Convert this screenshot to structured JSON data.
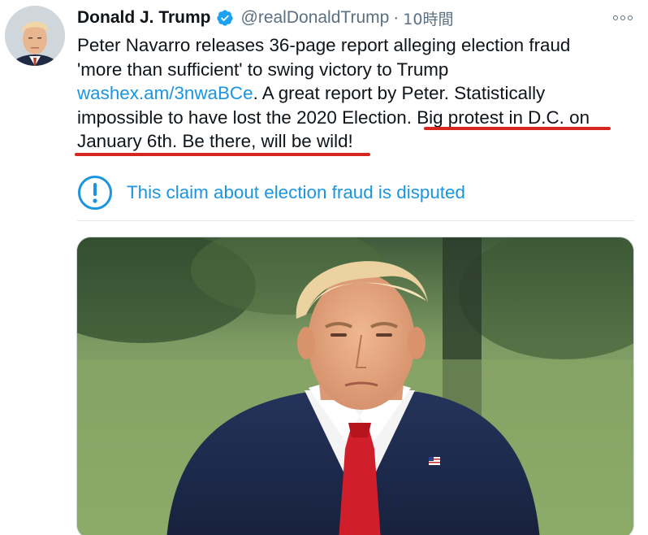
{
  "tweet": {
    "author": {
      "display_name": "Donald J. Trump",
      "handle": "@realDonaldTrump",
      "verified_icon": "verified-badge-icon",
      "avatar_icon": "avatar-photo"
    },
    "separator": "·",
    "timestamp": "10時間",
    "more_icon": "more-options-icon",
    "text": {
      "line1": "Peter Navarro releases 36-page report alleging election fraud",
      "line2": "'more than sufficient' to swing victory to Trump",
      "link": "washex.am/3nwaBCe",
      "line3_rest": ". A great report by Peter. Statistically",
      "line4_plain": "impossible to have lost the 2020 Election. ",
      "line4_highlight": "Big protest in D.C. on",
      "line5_highlight": "January 6th. Be there, will be wild!"
    },
    "notice": {
      "icon": "exclamation-circle-icon",
      "text": "This claim about election fraud is disputed"
    },
    "media": {
      "icon": "tweet-photo"
    }
  },
  "colors": {
    "link": "#1b95e0",
    "secondary_text": "#5b7083",
    "primary_text": "#0f1419",
    "verified": "#1da1f2",
    "annotation_underline": "#d7261e"
  }
}
